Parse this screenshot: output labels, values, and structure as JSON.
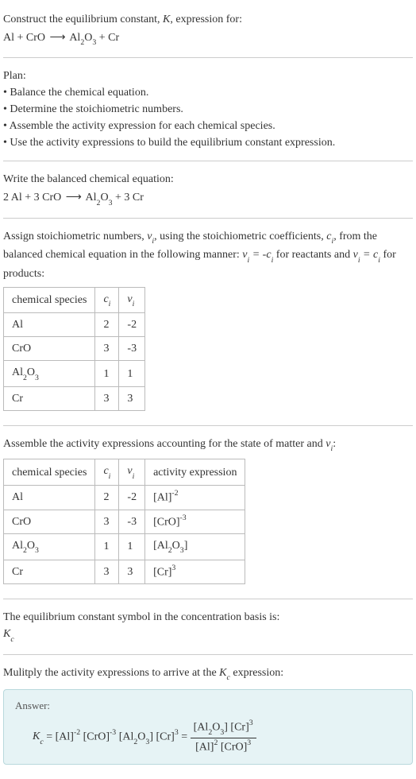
{
  "header": {
    "prompt": "Construct the equilibrium constant, ",
    "Ksym": "K",
    "prompt_after": ", expression for:"
  },
  "plan": {
    "title": "Plan:",
    "items": [
      "Balance the chemical equation.",
      "Determine the stoichiometric numbers.",
      "Assemble the activity expression for each chemical species.",
      "Use the activity expressions to build the equilibrium constant expression."
    ]
  },
  "balanced_heading": "Write the balanced chemical equation:",
  "assign_heading_1": "Assign stoichiometric numbers, ",
  "assign_heading_2": ", using the stoichiometric coefficients, ",
  "assign_heading_3": ", from the balanced chemical equation in the following manner: ",
  "assign_heading_4": " for reactants and ",
  "assign_heading_5": " for products:",
  "assemble_heading_1": "Assemble the activity expressions accounting for the state of matter and ",
  "assemble_heading_2": ":",
  "table1": {
    "headers": {
      "species": "chemical species"
    },
    "rows": [
      {
        "species": "Al",
        "ci": "2",
        "vi": "-2"
      },
      {
        "species": "CrO",
        "ci": "3",
        "vi": "-3"
      },
      {
        "species": "Al2O3",
        "ci": "1",
        "vi": "1"
      },
      {
        "species": "Cr",
        "ci": "3",
        "vi": "3"
      }
    ]
  },
  "table2": {
    "headers": {
      "species": "chemical species",
      "activity": "activity expression"
    },
    "rows": [
      {
        "species": "Al",
        "ci": "2",
        "vi": "-2"
      },
      {
        "species": "CrO",
        "ci": "3",
        "vi": "-3"
      },
      {
        "species": "Al2O3",
        "ci": "1",
        "vi": "1"
      },
      {
        "species": "Cr",
        "ci": "3",
        "vi": "3"
      }
    ]
  },
  "kc_symbol_heading": "The equilibrium constant symbol in the concentration basis is:",
  "multiply_heading": "Mulitply the activity expressions to arrive at the ",
  "multiply_heading_2": " expression:",
  "answer_label": "Answer:"
}
